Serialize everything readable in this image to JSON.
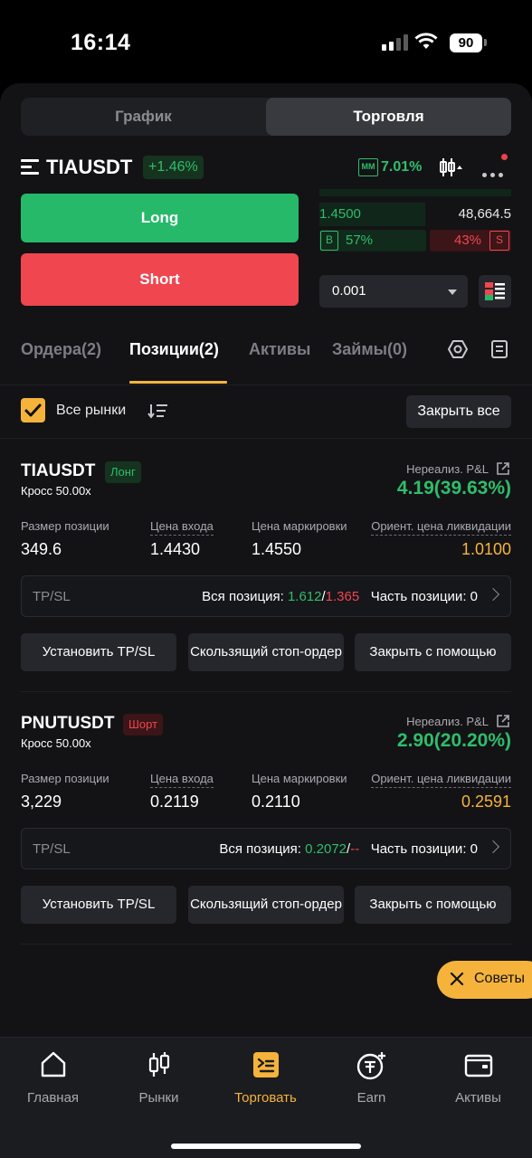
{
  "status_bar": {
    "time": "16:14",
    "battery": "90"
  },
  "view_toggle": {
    "chart": "График",
    "trade": "Торговля"
  },
  "ticker": {
    "symbol": "TIAUSDT",
    "change": "+1.46%",
    "mm_label": "MM",
    "mm_value": "7.01%"
  },
  "order_panel": {
    "long_label": "Long",
    "short_label": "Short"
  },
  "orderbook": {
    "price": "1.4500",
    "quantity": "48,664.5",
    "buy_tag": "B",
    "buy_pct": "57%",
    "sell_pct": "43%",
    "sell_tag": "S",
    "qty_value": "0.001"
  },
  "tabs": [
    {
      "label": "Ордера(2)"
    },
    {
      "label": "Позиции(2)"
    },
    {
      "label": "Активы"
    },
    {
      "label": "Займы(0)"
    }
  ],
  "filter": {
    "all_markets": "Все рынки",
    "close_all": "Закрыть все"
  },
  "columns": {
    "size": "Размер позиции",
    "entry": "Цена входа",
    "mark": "Цена маркировки",
    "liq": "Ориент. цена ликвидации",
    "pnl": "Нереализ. P&L"
  },
  "positions": [
    {
      "symbol": "TIAUSDT",
      "side": "Лонг",
      "margin": "Кросс 50.00x",
      "pnl": "4.19(39.63%)",
      "size": "349.6",
      "entry": "1.4430",
      "mark": "1.4550",
      "liq": "1.0100",
      "tpsl_label": "TP/SL",
      "full_label": "Вся позиция:",
      "tp": "1.612",
      "sl": "1.365",
      "partial": "Часть позиции: 0"
    },
    {
      "symbol": "PNUTUSDT",
      "side": "Шорт",
      "margin": "Кросс 50.00x",
      "pnl": "2.90(20.20%)",
      "size": "3,229",
      "entry": "0.2119",
      "mark": "0.2110",
      "liq": "0.2591",
      "tpsl_label": "TP/SL",
      "full_label": "Вся позиция:",
      "tp": "0.2072",
      "sl": "--",
      "partial": "Часть позиции: 0"
    }
  ],
  "actions": {
    "set_tpsl": "Установить TP/SL",
    "trailing": "Скользящий стоп-ордер",
    "close_with": "Закрыть с помощью"
  },
  "tips": {
    "label": "Советы"
  },
  "nav": [
    {
      "label": "Главная",
      "icon": "home-icon"
    },
    {
      "label": "Рынки",
      "icon": "markets-icon"
    },
    {
      "label": "Торговать",
      "icon": "trade-icon"
    },
    {
      "label": "Earn",
      "icon": "earn-icon"
    },
    {
      "label": "Активы",
      "icon": "wallet-icon"
    }
  ],
  "colors": {
    "green": "#2fbd6b",
    "red": "#ef4650",
    "accent": "#f5b33c"
  }
}
